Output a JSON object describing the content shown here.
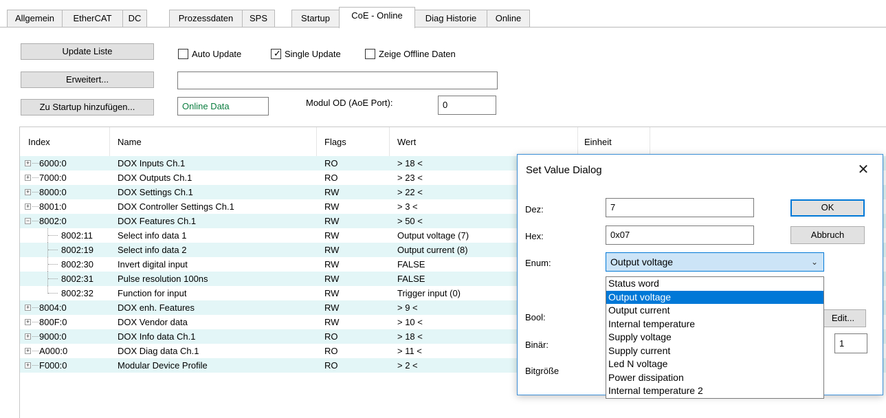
{
  "tabs": [
    {
      "label": "Allgemein",
      "active": false
    },
    {
      "label": "EtherCAT",
      "active": false
    },
    {
      "label": "DC",
      "active": false
    },
    {
      "label": "Prozessdaten",
      "active": false
    },
    {
      "label": "SPS",
      "active": false
    },
    {
      "label": "Startup",
      "active": false
    },
    {
      "label": "CoE - Online",
      "active": true
    },
    {
      "label": "Diag Historie",
      "active": false
    },
    {
      "label": "Online",
      "active": false
    }
  ],
  "controls": {
    "update_list": "Update Liste",
    "extended": "Erweitert...",
    "add_startup": "Zu Startup hinzufügen...",
    "auto_update": "Auto Update",
    "auto_update_checked": false,
    "single_update": "Single Update",
    "single_update_checked": true,
    "show_offline": "Zeige Offline Daten",
    "show_offline_checked": false,
    "path_value": "",
    "online_data": "Online Data",
    "module_od_label": "Modul OD (AoE Port):",
    "module_od_value": "0",
    "online_data_color": "#0a7d3f"
  },
  "table": {
    "headers": {
      "index": "Index",
      "name": "Name",
      "flags": "Flags",
      "value": "Wert",
      "unit": "Einheit"
    },
    "rows": [
      {
        "index": "6000:0",
        "name": "DOX Inputs Ch.1",
        "flags": "RO",
        "value": "> 18 <",
        "type": "collapsed"
      },
      {
        "index": "7000:0",
        "name": "DOX Outputs Ch.1",
        "flags": "RO",
        "value": "> 23 <",
        "type": "collapsed"
      },
      {
        "index": "8000:0",
        "name": "DOX Settings Ch.1",
        "flags": "RW",
        "value": "> 22 <",
        "type": "collapsed"
      },
      {
        "index": "8001:0",
        "name": "DOX Controller Settings Ch.1",
        "flags": "RW",
        "value": "> 3 <",
        "type": "collapsed"
      },
      {
        "index": "8002:0",
        "name": "DOX Features Ch.1",
        "flags": "RW",
        "value": "> 50 <",
        "type": "expanded"
      },
      {
        "index": "8002:11",
        "name": "Select info data 1",
        "flags": "RW",
        "value": "Output voltage (7)",
        "type": "child"
      },
      {
        "index": "8002:19",
        "name": "Select info data 2",
        "flags": "RW",
        "value": "Output current (8)",
        "type": "child"
      },
      {
        "index": "8002:30",
        "name": "Invert digital input",
        "flags": "RW",
        "value": "FALSE",
        "type": "child"
      },
      {
        "index": "8002:31",
        "name": "Pulse resolution 100ns",
        "flags": "RW",
        "value": "FALSE",
        "type": "child"
      },
      {
        "index": "8002:32",
        "name": "Function for input",
        "flags": "RW",
        "value": "Trigger input (0)",
        "type": "child-last"
      },
      {
        "index": "8004:0",
        "name": "DOX enh. Features",
        "flags": "RW",
        "value": "> 9 <",
        "type": "collapsed"
      },
      {
        "index": "800F:0",
        "name": "DOX Vendor data",
        "flags": "RW",
        "value": "> 10 <",
        "type": "collapsed"
      },
      {
        "index": "9000:0",
        "name": "DOX Info data Ch.1",
        "flags": "RO",
        "value": "> 18 <",
        "type": "collapsed"
      },
      {
        "index": "A000:0",
        "name": "DOX Diag data Ch.1",
        "flags": "RO",
        "value": "> 11 <",
        "type": "collapsed"
      },
      {
        "index": "F000:0",
        "name": "Modular Device Profile",
        "flags": "RO",
        "value": "> 2 <",
        "type": "collapsed"
      }
    ],
    "alt_row_color": "#e3f6f7"
  },
  "dialog": {
    "title": "Set Value Dialog",
    "close": "✕",
    "dec_label": "Dez:",
    "dec_value": "7",
    "hex_label": "Hex:",
    "hex_value": "0x07",
    "enum_label": "Enum:",
    "enum_selected": "Output voltage",
    "bool_label": "Bool:",
    "binary_label": "Binär:",
    "bitsize_label": "Bitgröße",
    "bitsize_value": "1",
    "ok_label": "OK",
    "cancel_label": "Abbruch",
    "edit_label": "Edit...",
    "options": [
      "Status word",
      "Output voltage",
      "Output current",
      "Internal temperature",
      "Supply voltage",
      "Supply current",
      "Led N voltage",
      "Power dissipation",
      "Internal temperature 2"
    ],
    "selected_option_index": 1,
    "accent_color": "#0078d7"
  }
}
